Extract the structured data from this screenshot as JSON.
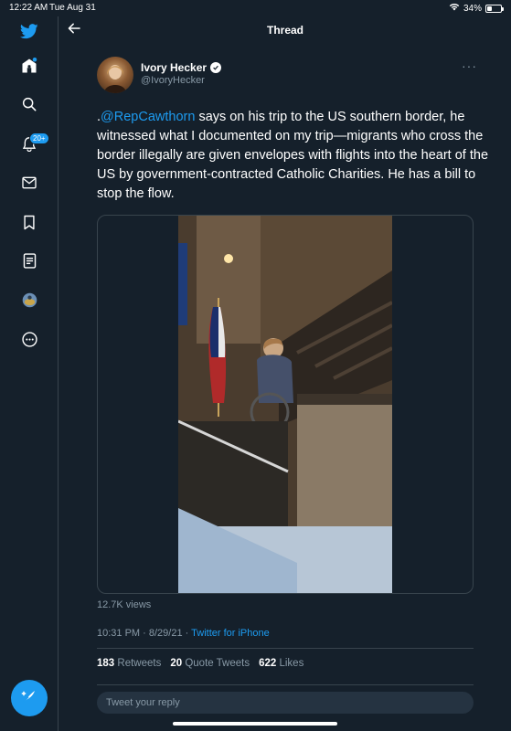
{
  "status_bar": {
    "time": "12:22 AM",
    "date": "Tue Aug 31",
    "battery": "34%",
    "battery_level": 0.34
  },
  "sidebar": {
    "items": [
      {
        "icon": "twitter-logo-icon"
      },
      {
        "icon": "home-icon"
      },
      {
        "icon": "explore-icon"
      },
      {
        "icon": "notifications-icon",
        "badge": "20+"
      },
      {
        "icon": "messages-icon"
      },
      {
        "icon": "bookmarks-icon"
      },
      {
        "icon": "lists-icon"
      },
      {
        "icon": "profile-avatar-icon"
      },
      {
        "icon": "more-icon"
      }
    ],
    "compose_icon": "compose-tweet-icon"
  },
  "header": {
    "title": "Thread"
  },
  "tweet": {
    "author_name": "Ivory Hecker",
    "author_handle": "@IvoryHecker",
    "text_prefix": ".",
    "mention": "@RepCawthorn",
    "text_body": " says on his trip to the US southern border, he witnessed what I documented on my trip—migrants who cross the border illegally are given envelopes with flights into the heart of the US by government-contracted Catholic Charities. He has a bill to stop the flow.",
    "views": "12.7K views",
    "timestamp": "10:31 PM · 8/29/21 · ",
    "source": "Twitter for iPhone",
    "retweets_count": "183",
    "retweets_label": "Retweets",
    "quote_count": "20",
    "quote_label": "Quote Tweets",
    "likes_count": "622",
    "likes_label": "Likes"
  },
  "reply": {
    "placeholder": "Tweet your reply"
  },
  "colors": {
    "background": "#15202b",
    "accent": "#1d9bf0",
    "secondary_text": "#8899a6",
    "border": "#38444d"
  }
}
